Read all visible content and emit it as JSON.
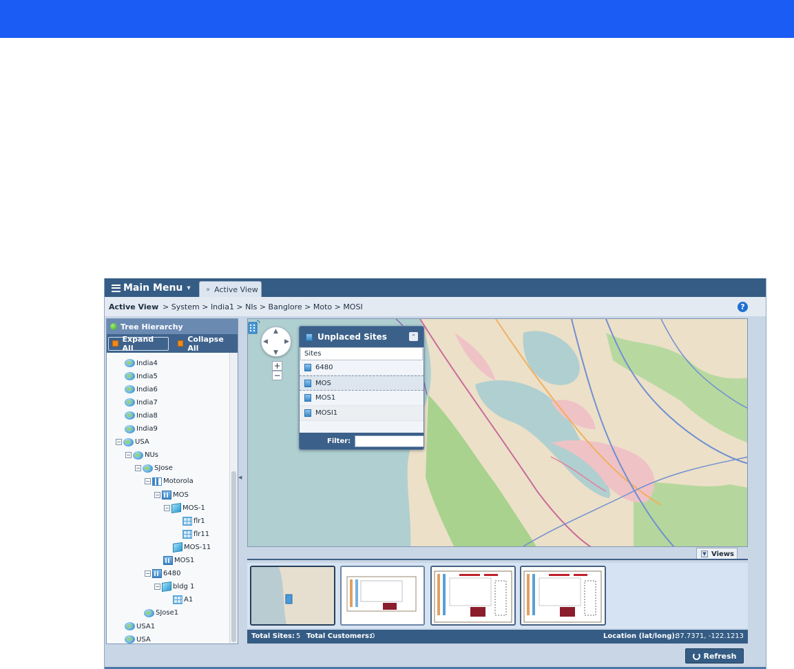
{
  "header": {
    "menu_label": "Main Menu",
    "tab_label": "Active View"
  },
  "breadcrumb": {
    "title": "Active View",
    "path": "> System > India1 > NIs > Banglore > Moto > MOSI",
    "help_label": "?"
  },
  "tree": {
    "title": "Tree Hierarchy",
    "expand_label": "Expand All",
    "collapse_label": "Collapse All",
    "nodes": [
      {
        "label": "India4",
        "icon": "globe-icon"
      },
      {
        "label": "India5",
        "icon": "globe-icon"
      },
      {
        "label": "India6",
        "icon": "globe-icon"
      },
      {
        "label": "India7",
        "icon": "globe-icon"
      },
      {
        "label": "India8",
        "icon": "globe-icon"
      },
      {
        "label": "India9",
        "icon": "globe-icon"
      },
      {
        "label": "USA",
        "icon": "globe-icon",
        "expanded": true
      },
      {
        "label": "NUs",
        "icon": "globe-icon",
        "expanded": true
      },
      {
        "label": "SJose",
        "icon": "globe-icon",
        "expanded": true
      },
      {
        "label": "Motorola",
        "icon": "org-icon",
        "expanded": true
      },
      {
        "label": "MOS",
        "icon": "building-icon",
        "expanded": true
      },
      {
        "label": "MOS-1",
        "icon": "cube-icon",
        "expanded": true
      },
      {
        "label": "flr1",
        "icon": "floor-icon"
      },
      {
        "label": "flr11",
        "icon": "floor-icon"
      },
      {
        "label": "MOS-11",
        "icon": "cube-icon"
      },
      {
        "label": "MOS1",
        "icon": "building-icon"
      },
      {
        "label": "6480",
        "icon": "building-icon",
        "expanded": true
      },
      {
        "label": "bldg 1",
        "icon": "cube-icon",
        "expanded": true
      },
      {
        "label": "A1",
        "icon": "floor-icon"
      },
      {
        "label": "SJose1",
        "icon": "globe-icon"
      },
      {
        "label": "USA1",
        "icon": "globe-icon"
      },
      {
        "label": "USA",
        "icon": "globe-icon"
      }
    ]
  },
  "unplaced": {
    "title": "Unplaced Sites",
    "column": "Sites",
    "sites": [
      "6480",
      "MOS",
      "MOS1",
      "MOSI1"
    ],
    "filter_label": "Filter:"
  },
  "map": {
    "zoom_in": "+",
    "zoom_out": "−"
  },
  "views": {
    "label": "Views"
  },
  "status": {
    "total_sites_label": "Total Sites:",
    "total_sites": "5",
    "total_customers_label": "Total Customers:",
    "total_customers": "0",
    "location_label": "Location (lat/long):",
    "location": "37.7371, -122.1213"
  },
  "actions": {
    "refresh_label": "Refresh"
  },
  "colors": {
    "accent": "#1b5cf4",
    "header": "#355c84",
    "panel": "#c9d6e6"
  }
}
